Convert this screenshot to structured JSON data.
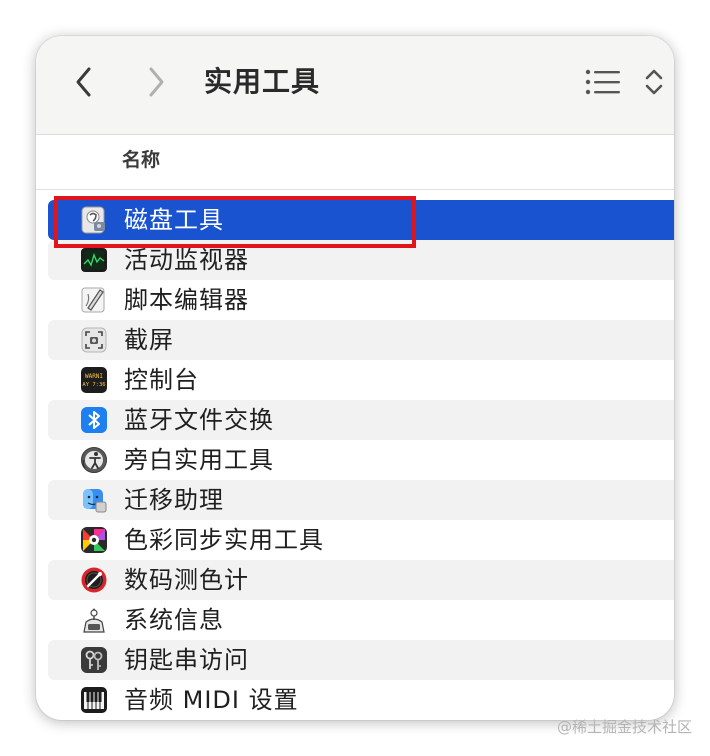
{
  "toolbar": {
    "title": "实用工具"
  },
  "header": {
    "name_column": "名称"
  },
  "items": [
    {
      "label": "磁盘工具",
      "icon": "disk-utility-icon"
    },
    {
      "label": "活动监视器",
      "icon": "activity-monitor-icon"
    },
    {
      "label": "脚本编辑器",
      "icon": "script-editor-icon"
    },
    {
      "label": "截屏",
      "icon": "screenshot-icon"
    },
    {
      "label": "控制台",
      "icon": "console-icon"
    },
    {
      "label": "蓝牙文件交换",
      "icon": "bluetooth-icon"
    },
    {
      "label": "旁白实用工具",
      "icon": "voiceover-icon"
    },
    {
      "label": "迁移助理",
      "icon": "migration-assistant-icon"
    },
    {
      "label": "色彩同步实用工具",
      "icon": "colorsync-icon"
    },
    {
      "label": "数码测色计",
      "icon": "digital-color-meter-icon"
    },
    {
      "label": "系统信息",
      "icon": "system-information-icon"
    },
    {
      "label": "钥匙串访问",
      "icon": "keychain-access-icon"
    },
    {
      "label": "音频 MIDI 设置",
      "icon": "audio-midi-icon"
    }
  ],
  "console_icon_text": [
    "WARNI",
    "AY 7:36"
  ],
  "watermark": "@稀土掘金技术社区",
  "colors": {
    "selection": "#1a53d0",
    "highlight_box": "#e0141b",
    "alt_row": "#f2f2f2"
  }
}
